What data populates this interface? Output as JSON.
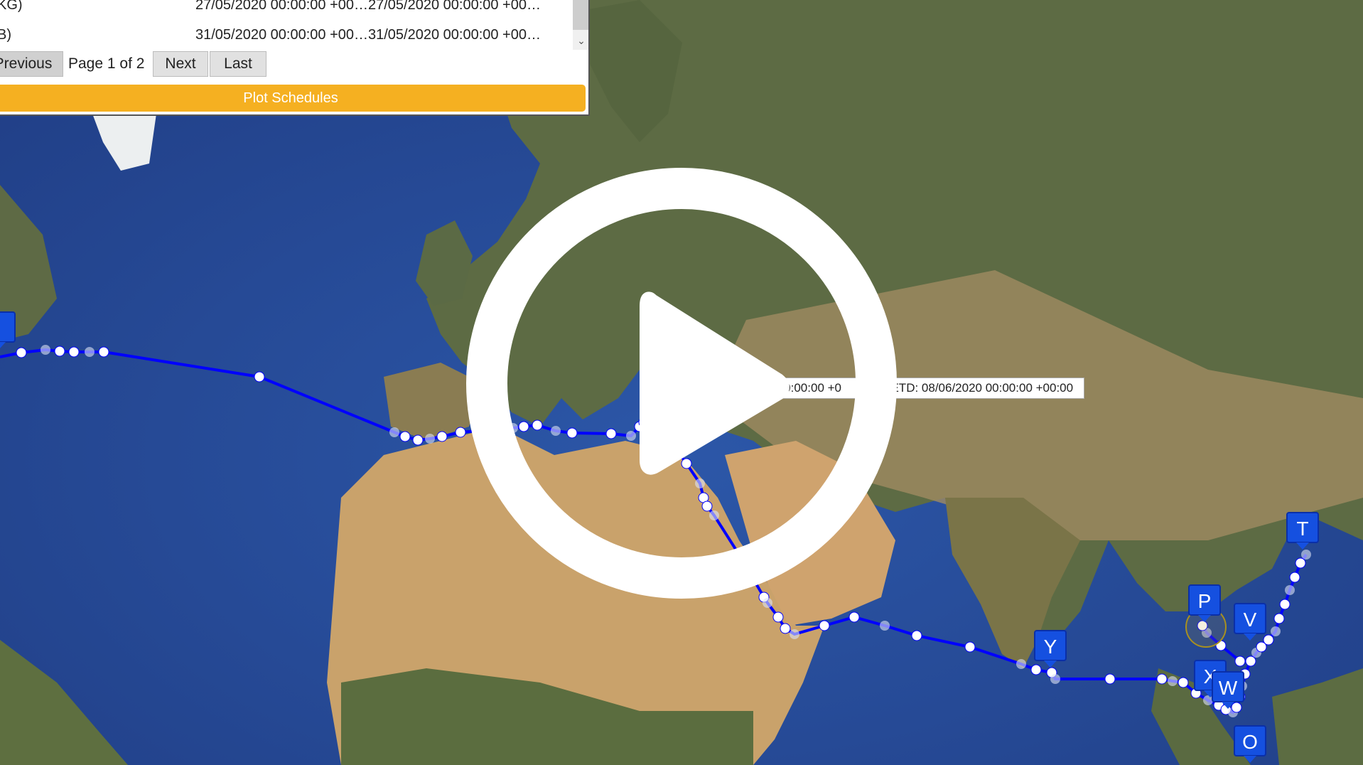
{
  "schedule_panel": {
    "rows": [
      {
        "port_suffix": "KG)",
        "eta_etd": "27/05/2020 00:00:00 +00…27/05/2020 00:00:00 +00…"
      },
      {
        "port_suffix": "B)",
        "eta_etd": "31/05/2020 00:00:00 +00…31/05/2020 00:00:00 +00…"
      }
    ],
    "pagination": {
      "previous_label": "Previous",
      "page_info": "Page 1 of 2",
      "next_label": "Next",
      "last_label": "Last"
    },
    "plot_button_label": "Plot Schedules",
    "scroll_arrow": "⌄"
  },
  "map": {
    "basemap": "satellite",
    "route_color": "#0000ff",
    "accent_marker_color": "#1550e0",
    "port_markers": [
      {
        "label": "Y"
      },
      {
        "label": "P"
      },
      {
        "label": "V"
      },
      {
        "label": "X"
      },
      {
        "label": "W"
      },
      {
        "label": "O"
      },
      {
        "label": "T"
      }
    ],
    "tooltip": {
      "left_text": "̃6/2020 00:00:00 +0",
      "right_text": "ETD: 08/06/2020 00:00:00 +00:00"
    }
  },
  "video_overlay": {
    "icon": "play-icon"
  }
}
